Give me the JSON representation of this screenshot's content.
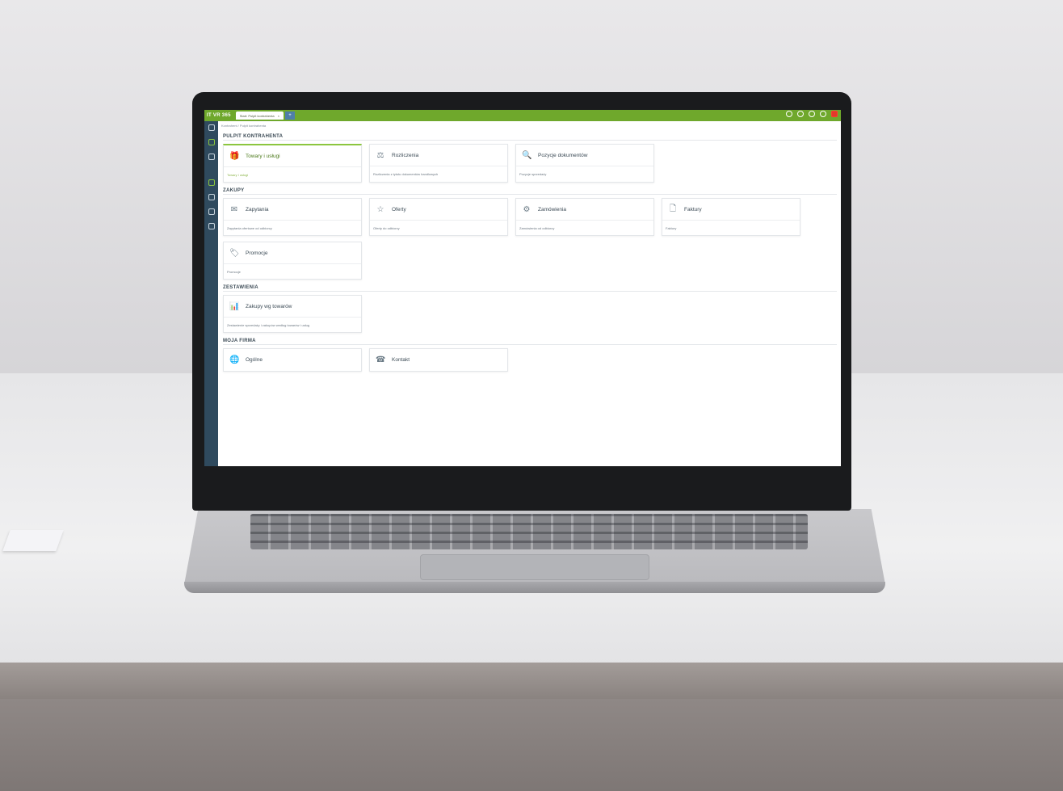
{
  "app": {
    "logo": "IT VR 365",
    "tab_label": "Start: Pulpit kontrahenta",
    "tab_close": "×",
    "tab_add": "+",
    "breadcrumb": "Kontrahent / Pulpit kontrahenta"
  },
  "sections": [
    {
      "title": "PULPIT KONTRAHENTA",
      "cards": [
        {
          "icon": "gift-icon",
          "glyph": "🎁",
          "title": "Towary i usługi",
          "sub": "Towary i usługi",
          "active": true
        },
        {
          "icon": "settlements-icon",
          "glyph": "⚖",
          "title": "Rozliczenia",
          "sub": "Rozliczenia z tytułu dokumentów handlowych"
        },
        {
          "icon": "document-search-icon",
          "glyph": "🔍",
          "title": "Pozycje dokumentów",
          "sub": "Pozycje sprzedaży"
        }
      ]
    },
    {
      "title": "ZAKUPY",
      "cards": [
        {
          "icon": "inquiry-icon",
          "glyph": "✉",
          "title": "Zapytania",
          "sub": "Zapytania ofertowe od odbiorcy"
        },
        {
          "icon": "star-icon",
          "glyph": "☆",
          "title": "Oferty",
          "sub": "Oferty do odbiorcy"
        },
        {
          "icon": "order-icon",
          "glyph": "⚙",
          "title": "Zamówienia",
          "sub": "Zamówienia od odbiorcy"
        },
        {
          "icon": "invoice-icon",
          "glyph": "🗋",
          "title": "Faktury",
          "sub": "Faktury"
        },
        {
          "icon": "tag-icon",
          "glyph": "🏷",
          "title": "Promocje",
          "sub": "Promocje"
        }
      ]
    },
    {
      "title": "ZESTAWIENIA",
      "cards": [
        {
          "icon": "report-icon",
          "glyph": "📊",
          "title": "Zakupy wg towarów",
          "sub": "Zestawienie sprzedaży i zakupów według towarów i usług"
        }
      ]
    },
    {
      "title": "MOJA FIRMA",
      "cards": [
        {
          "icon": "globe-icon",
          "glyph": "🌐",
          "title": "Ogólne",
          "compact": true
        },
        {
          "icon": "phone-icon",
          "glyph": "☎",
          "title": "Kontakt",
          "compact": true
        }
      ]
    }
  ]
}
